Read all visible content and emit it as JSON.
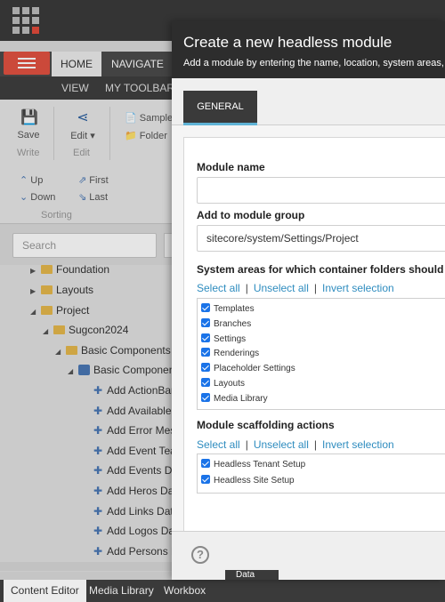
{
  "ribbon": {
    "tabs": [
      "HOME",
      "NAVIGATE"
    ],
    "subtabs": [
      "VIEW",
      "MY TOOLBAR"
    ],
    "save_label": "Save",
    "edit_label": "Edit",
    "write_group": "Write",
    "edit_group": "Edit",
    "sample_label": "Sample",
    "folder_label": "Folder",
    "up_label": "Up",
    "down_label": "Down",
    "first_label": "First",
    "last_label": "Last",
    "sorting_group": "Sorting"
  },
  "search": {
    "placeholder": "Search"
  },
  "tree": {
    "foundation": "Foundation",
    "layouts": "Layouts",
    "project": "Project",
    "sugcon": "Sugcon2024",
    "basic_components": "Basic Components",
    "basic_component_item": "Basic Component",
    "items": [
      "Add ActionBan",
      "Add Available F",
      "Add Error Mess",
      "Add Event Teas",
      "Add Events Day",
      "Add Heros Dat",
      "Add Links Data",
      "Add Logos Data",
      "Add Persons D"
    ]
  },
  "statusbar": {
    "tabs": [
      "Content Editor",
      "Media Library",
      "Workbox"
    ],
    "data_label": "Data"
  },
  "dialog": {
    "title": "Create a new headless module",
    "subtitle": "Add a module by entering the name, location, system areas,",
    "tab": "GENERAL",
    "module_name_label": "Module name",
    "module_name_value": "",
    "group_label": "Add to module group",
    "group_value": "sitecore/system/Settings/Project",
    "system_areas_label": "System areas for which container folders should be cr",
    "select_all": "Select all",
    "unselect_all": "Unselect all",
    "invert_selection": "Invert selection",
    "system_areas": [
      "Templates",
      "Branches",
      "Settings",
      "Renderings",
      "Placeholder Settings",
      "Layouts",
      "Media Library"
    ],
    "scaffolding_label": "Module scaffolding actions",
    "scaffolding": [
      "Headless Tenant Setup",
      "Headless Site Setup"
    ],
    "help_glyph": "?"
  },
  "colors": {
    "accent_red": "#e35241",
    "link_blue": "#2e8cbf",
    "checkbox_blue": "#1a73e8",
    "header_dark": "#2d2d2d"
  }
}
